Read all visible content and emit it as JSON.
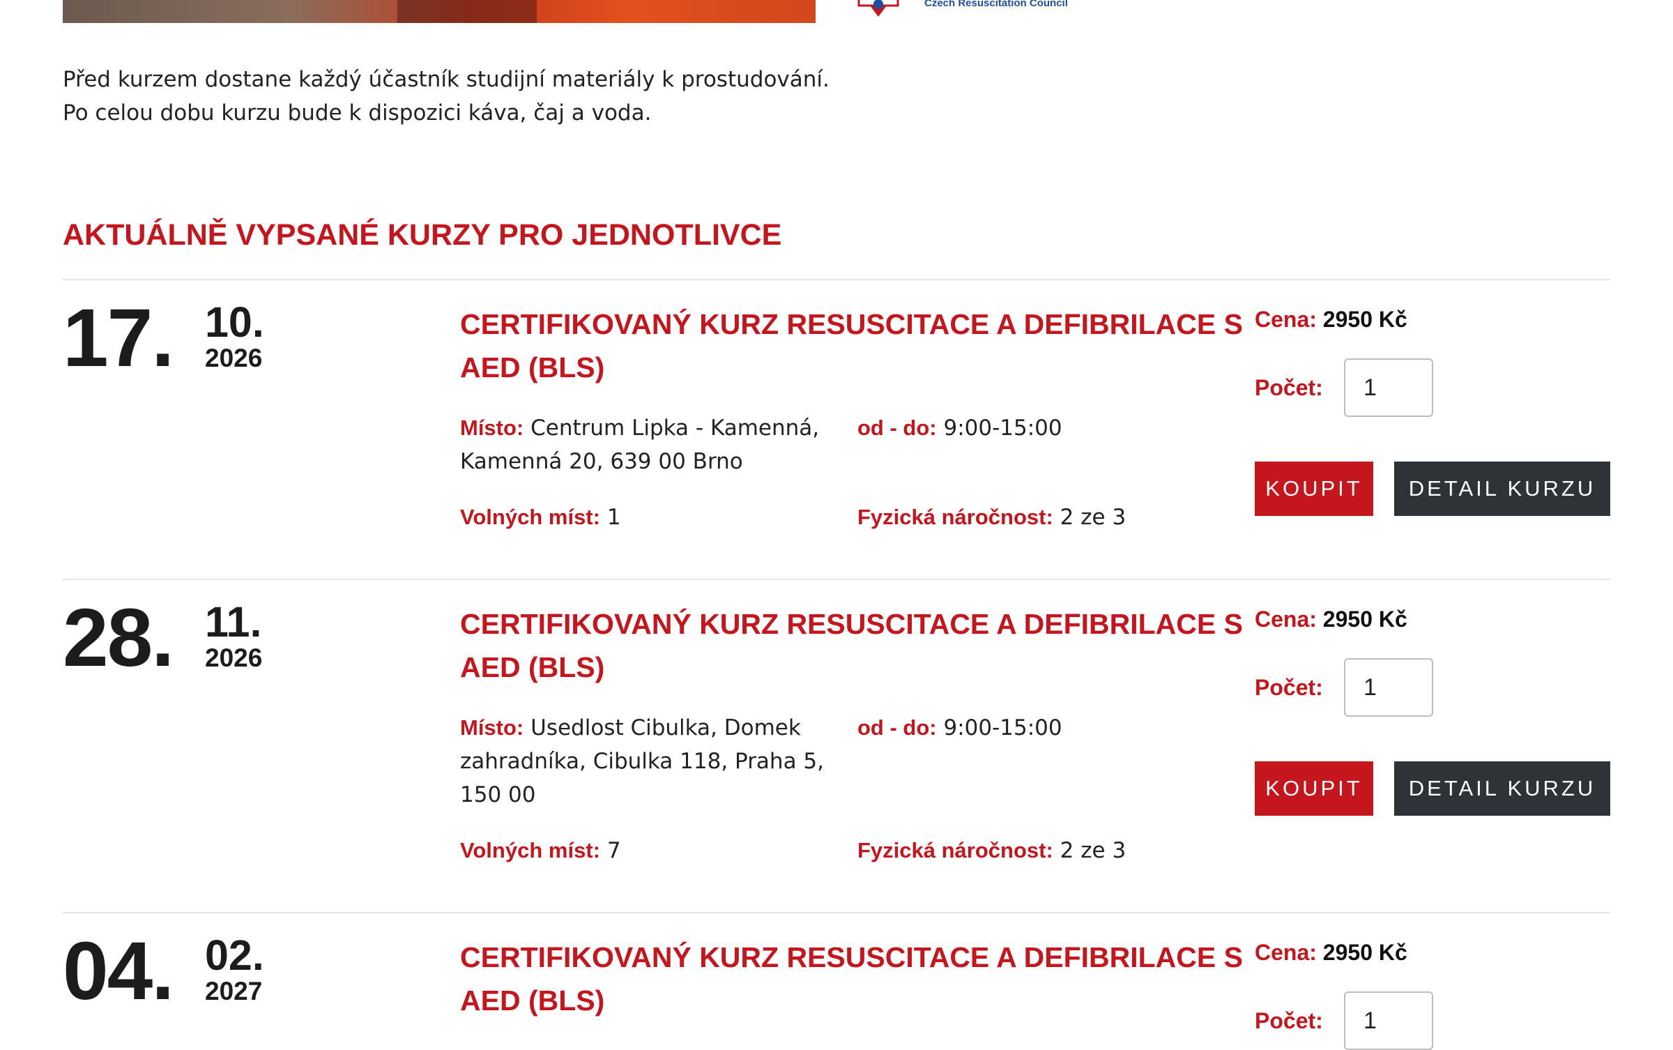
{
  "colors": {
    "accent": "#c4161c",
    "dark_button": "#2e3338",
    "text": "#222222",
    "divider": "#e6e6e6"
  },
  "partner": {
    "logo_text": "Czech Resuscitation Council"
  },
  "intro": {
    "line1": "Před kurzem dostane každý účastník studijní materiály k prostudování.",
    "line2": "Po celou dobu kurzu bude k dispozici káva, čaj a voda."
  },
  "section": {
    "title": "AKTUÁLNĚ VYPSANÉ KURZY PRO JEDNOTLIVCE"
  },
  "labels": {
    "place": "Místo:",
    "time": "od - do:",
    "seats": "Volných míst:",
    "difficulty": "Fyzická náročnost:",
    "price": "Cena:",
    "quantity": "Počet:",
    "buy": "KOUPIT",
    "detail": "DETAIL KURZU"
  },
  "courses": [
    {
      "day": "17.",
      "month": "10.",
      "year": "2026",
      "title": "CERTIFIKOVANÝ KURZ RESUSCITACE A DEFIBRILACE S AED (BLS)",
      "place": "Centrum Lipka - Kamenná, Kamenná 20, 639 00 Brno",
      "time": "9:00-15:00",
      "seats": "1",
      "difficulty": "2 ze 3",
      "price": "2950 Kč",
      "quantity": "1"
    },
    {
      "day": "28.",
      "month": "11.",
      "year": "2026",
      "title": "CERTIFIKOVANÝ KURZ RESUSCITACE A DEFIBRILACE S AED (BLS)",
      "place": "Usedlost Cibulka, Domek zahradníka, Cibulka 118, Praha 5, 150 00",
      "time": "9:00-15:00",
      "seats": "7",
      "difficulty": "2 ze 3",
      "price": "2950 Kč",
      "quantity": "1"
    },
    {
      "day": "04.",
      "month": "02.",
      "year": "2027",
      "title": "CERTIFIKOVANÝ KURZ RESUSCITACE A DEFIBRILACE S AED (BLS)",
      "price": "2950 Kč",
      "quantity": "1"
    }
  ]
}
